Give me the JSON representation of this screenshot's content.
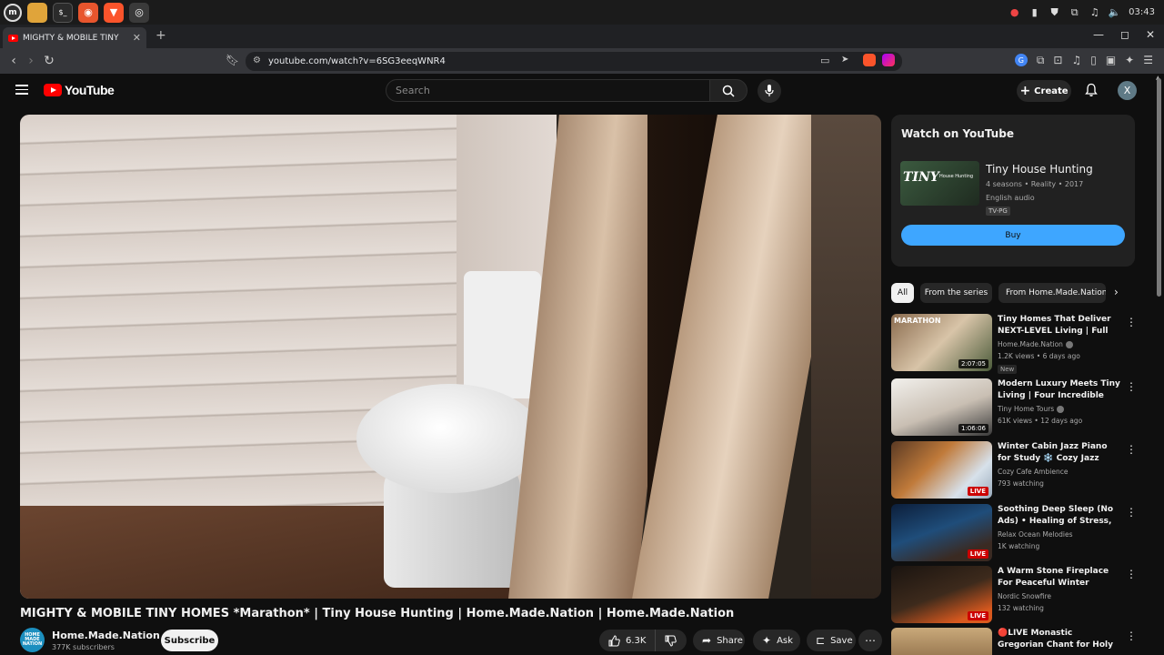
{
  "os": {
    "clock": "03:43",
    "apps": [
      "mint-menu-icon",
      "files-icon",
      "terminal-icon",
      "firefox-icon",
      "brave-icon",
      "chromium-icon"
    ]
  },
  "browser": {
    "tab_title": "MIGHTY & MOBILE TINY HO",
    "url": "youtube.com/watch?v=6SG3eeqWNR4",
    "win_minimize": "—",
    "win_maximize": "◻",
    "win_close": "✕"
  },
  "youtube": {
    "logo_text": "YouTube",
    "search_placeholder": "Search",
    "create_label": "Create",
    "avatar_initial": "X"
  },
  "video": {
    "title": "MIGHTY & MOBILE TINY HOMES *Marathon* | Tiny House Hunting | Home.Made.Nation | Home.Made.Nation",
    "channel_name": "Home.Made.Nation",
    "channel_avatar_text": "HOME MADE NATION",
    "subscribers": "377K subscribers",
    "subscribe_label": "Subscribe",
    "likes": "6.3K",
    "share_label": "Share",
    "ask_label": "Ask",
    "save_label": "Save"
  },
  "watch_card": {
    "heading": "Watch on YouTube",
    "show_title": "Tiny House Hunting",
    "thumb_text": "TINY",
    "thumb_sub": "House Hunting",
    "meta": "4 seasons • Reality • 2017",
    "audio": "English audio",
    "rating": "TV-PG",
    "buy_label": "Buy"
  },
  "chips": [
    "All",
    "From the series",
    "From Home.Made.Nation"
  ],
  "recommendations": [
    {
      "title": "Tiny Homes That Deliver NEXT-LEVEL Living | Full Ep ...",
      "channel": "Home.Made.Nation",
      "verified": true,
      "stats": "1.2K views • 6 days ago",
      "badge": "New",
      "duration": "2:07:05",
      "live": false
    },
    {
      "title": "Modern Luxury Meets Tiny Living | Four Incredible Tiny ...",
      "channel": "Tiny Home Tours",
      "verified": true,
      "stats": "61K views • 12 days ago",
      "badge": "",
      "duration": "1:06:06",
      "live": false
    },
    {
      "title": "Winter Cabin Jazz Piano for Study ❄️ Cozy Jazz with ...",
      "channel": "Cozy Cafe Ambience",
      "verified": false,
      "stats": "793 watching",
      "badge": "",
      "duration": "",
      "live": true
    },
    {
      "title": "Soothing Deep Sleep (No Ads) • Healing of Stress, Anxiety and ...",
      "channel": "Relax Ocean Melodies",
      "verified": false,
      "stats": "1K watching",
      "badge": "",
      "duration": "",
      "live": true
    },
    {
      "title": "A Warm Stone Fireplace For Peaceful Winter Nights 🔥Win...",
      "channel": "Nordic Snowfire",
      "verified": false,
      "stats": "132 watching",
      "badge": "",
      "duration": "",
      "live": true
    },
    {
      "title": "🔴LIVE Monastic Gregorian Chant for Holy Stillness | ...",
      "channel": "",
      "verified": false,
      "stats": "",
      "badge": "",
      "duration": "",
      "live": false
    }
  ],
  "live_label": "LIVE",
  "colors": {
    "brand_red": "#ff0000",
    "buy_blue": "#3ea6ff",
    "background": "#0f0f0f"
  }
}
